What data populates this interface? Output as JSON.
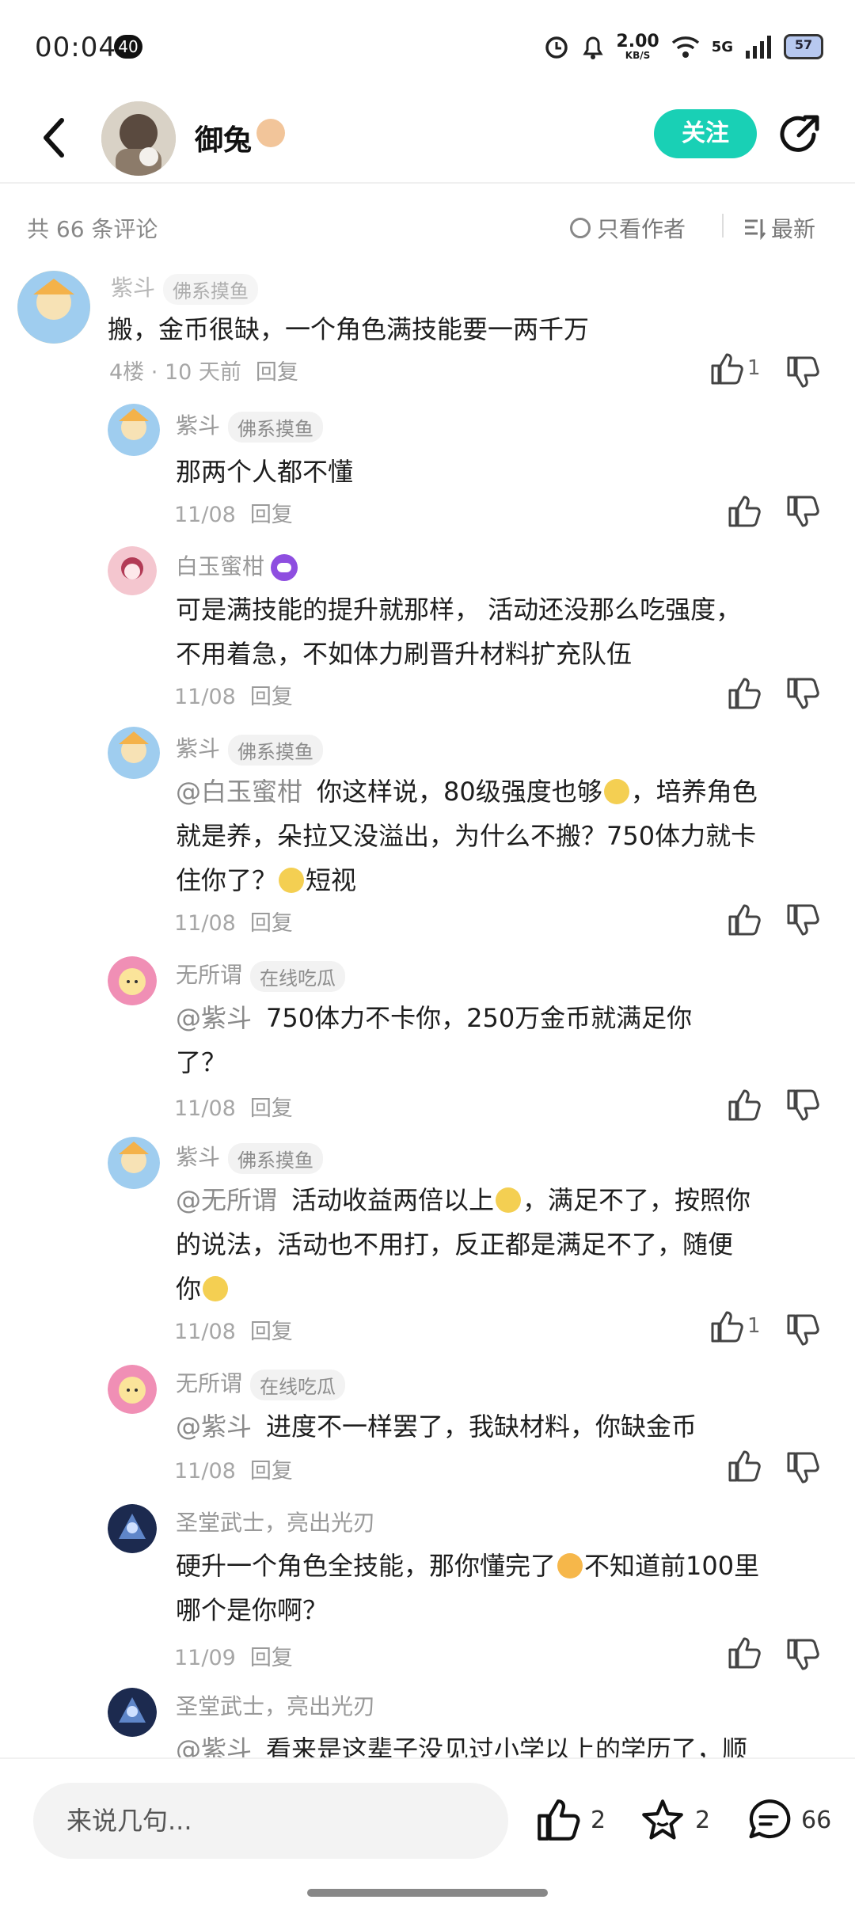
{
  "status_bar": {
    "time": "00:04",
    "badge": "40",
    "speed_value": "2.00",
    "speed_unit": "KB/S",
    "network": "5G",
    "battery": "57"
  },
  "header": {
    "author_name": "御兔",
    "follow_label": "关注"
  },
  "subheader": {
    "count_label": "共 66 条评论",
    "only_author_label": "只看作者",
    "sort_label": "最新"
  },
  "comments": [
    {
      "name": "紫斗",
      "tag": "佛系摸鱼",
      "text": "搬，金币很缺，一个角色满技能要一两千万",
      "floor": "4楼",
      "date": "10 天前",
      "reply": "回复",
      "likes": "1"
    },
    {
      "name": "紫斗",
      "tag": "佛系摸鱼",
      "text": "那两个人都不懂",
      "date": "11/08",
      "reply": "回复"
    },
    {
      "name": "白玉蜜柑",
      "text_line1": "可是满技能的提升就那样，  活动还没那么吃强度，",
      "text_line2": "不用着急，不如体力刷晋升材料扩充队伍",
      "date": "11/08",
      "reply": "回复"
    },
    {
      "name": "紫斗",
      "tag": "佛系摸鱼",
      "mention": "@白玉蜜柑",
      "text_line1": "你这样说，80级强度也够",
      "text_line1b": "，培养角色",
      "text_line2": "就是养，朵拉又没溢出，为什么不搬？750体力就卡",
      "text_line3a": "住你了？",
      "text_line3b": "短视",
      "date": "11/08",
      "reply": "回复"
    },
    {
      "name": "无所谓",
      "tag": "在线吃瓜",
      "mention": "@紫斗",
      "text_line1": "750体力不卡你，250万金币就满足你",
      "text_line2": "了？",
      "date": "11/08",
      "reply": "回复"
    },
    {
      "name": "紫斗",
      "tag": "佛系摸鱼",
      "mention": "@无所谓",
      "text_line1a": "活动收益两倍以上",
      "text_line1b": "，满足不了，按照你",
      "text_line2": "的说法，活动也不用打，反正都是满足不了，随便",
      "text_line3": "你",
      "date": "11/08",
      "reply": "回复",
      "likes": "1"
    },
    {
      "name": "无所谓",
      "tag": "在线吃瓜",
      "mention": "@紫斗",
      "text_line1": "进度不一样罢了，我缺材料，你缺金币",
      "date": "11/08",
      "reply": "回复"
    },
    {
      "name": "圣堂武士，亮出光刃",
      "text_line1a": "硬升一个角色全技能，那你懂完了",
      "text_line1b": "不知道前100里",
      "text_line2": "哪个是你啊？",
      "date": "11/09",
      "reply": "回复"
    },
    {
      "name": "圣堂武士，亮出光刃",
      "mention": "@紫斗",
      "text_line1": "看来是这辈子没见过小学以上的学历了，顺"
    }
  ],
  "bottom_bar": {
    "input_placeholder": "来说几句...",
    "likes": "2",
    "favorites": "2",
    "comments": "66"
  },
  "colors": {
    "accent": "#19d0b5",
    "muted_text": "#999999"
  }
}
